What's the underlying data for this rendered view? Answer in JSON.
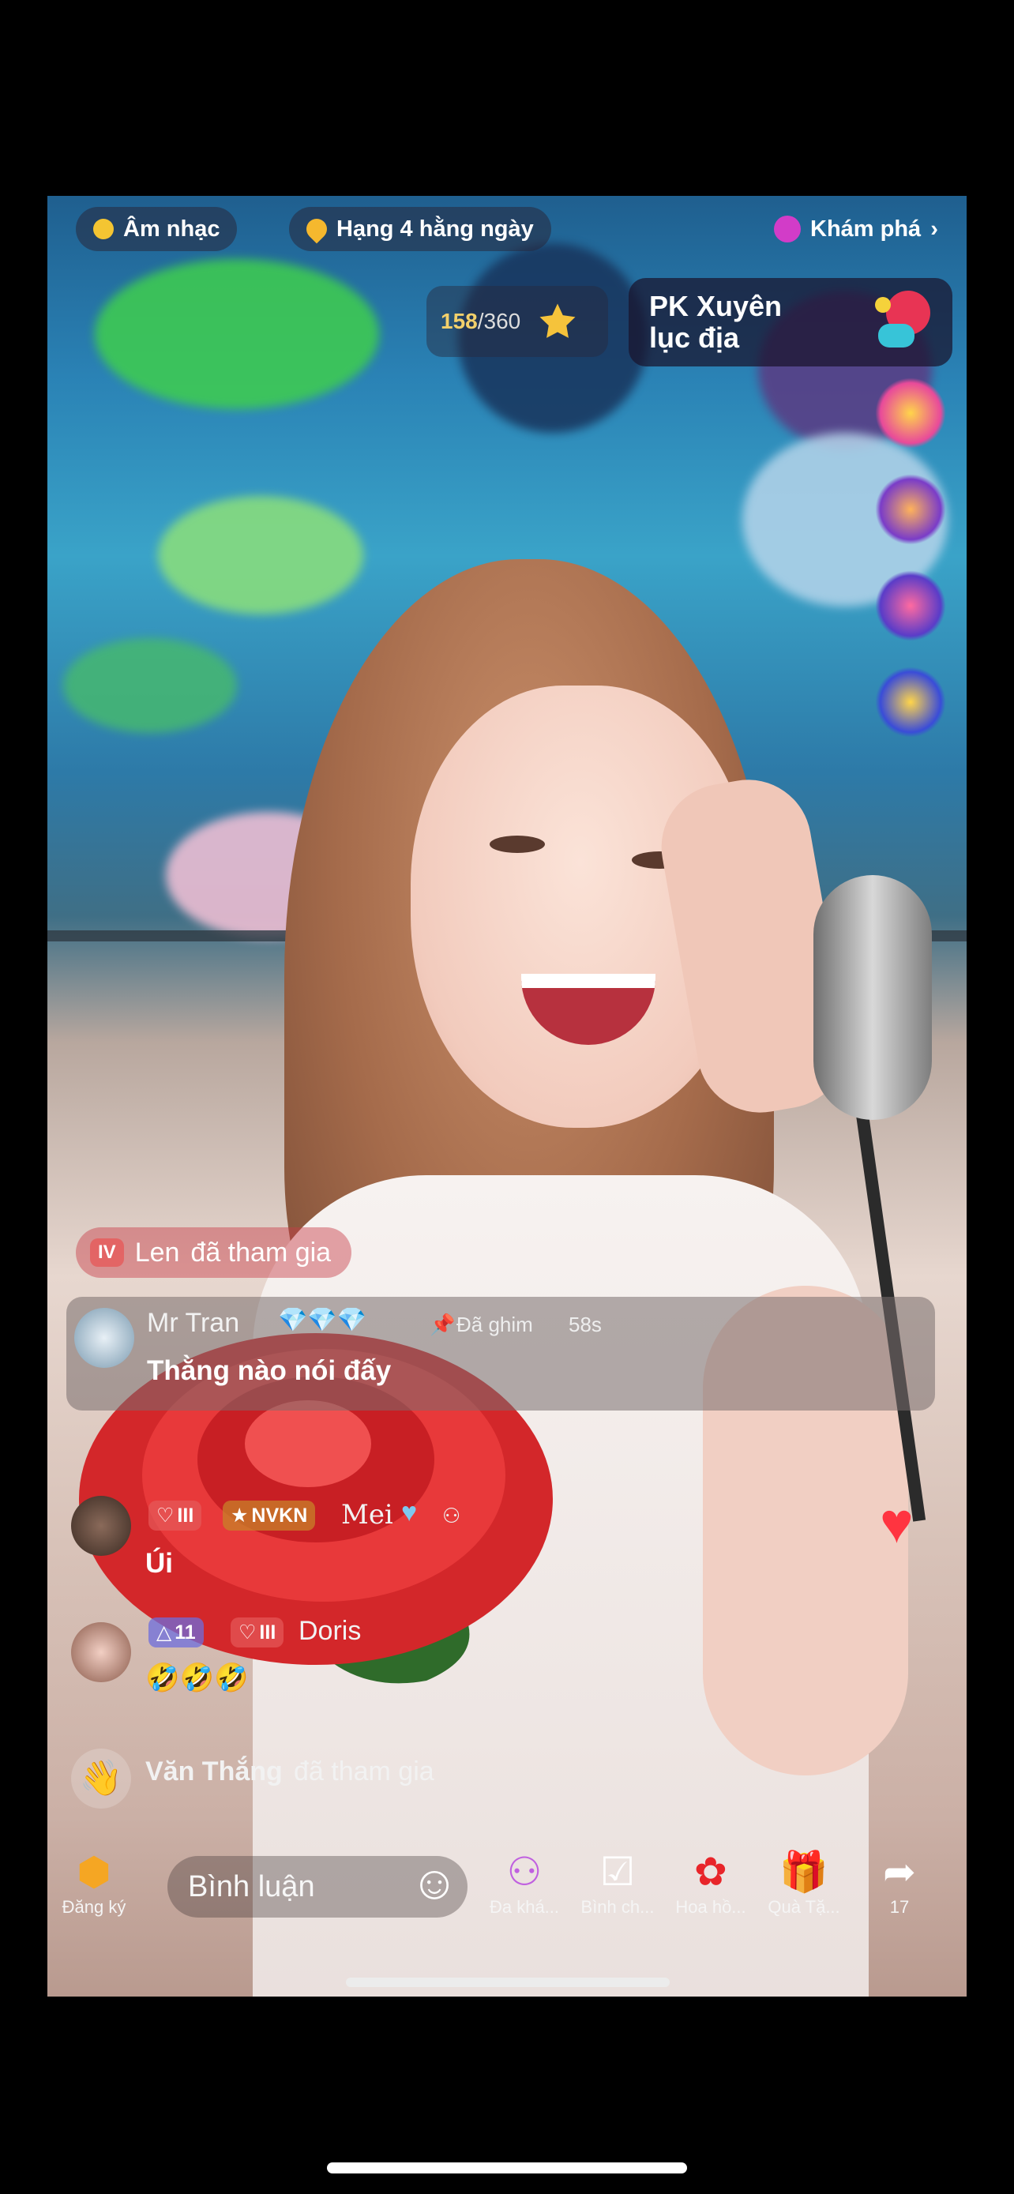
{
  "top_bar": {
    "music_chip": "Âm nhạc",
    "rank_chip": "Hạng 4 hằng ngày",
    "explore": "Khám phá",
    "explore_chevron": "›"
  },
  "progress": {
    "current": "158",
    "separator": "/",
    "total": "360"
  },
  "pk_banner": {
    "title": "PK Xuyên lục địa"
  },
  "chat": {
    "join_1": {
      "level": "IV",
      "user": "Len",
      "text": "đã tham gia"
    },
    "pinned": {
      "user": "Mr Tran",
      "diamonds": "💎💎💎",
      "pin_label": "Đã ghim",
      "time": "58s",
      "message": "Thằng nào nói đấy"
    },
    "msg_2": {
      "level": "III",
      "badge": "NVKN",
      "user": "Mei",
      "message": "Úi"
    },
    "msg_3": {
      "rank_level": "11",
      "level": "III",
      "user": "Doris",
      "message": "🤣🤣🤣"
    },
    "join_2": {
      "user": "Văn Thắng",
      "text": "đã tham gia"
    }
  },
  "bottom_bar": {
    "subscribe_label": "Đăng ký",
    "comment_placeholder": "Bình luận",
    "tools": [
      "Đa khá...",
      "Bình ch...",
      "Hoa hồ...",
      "Quà Tặ..."
    ],
    "share_count": "17"
  }
}
